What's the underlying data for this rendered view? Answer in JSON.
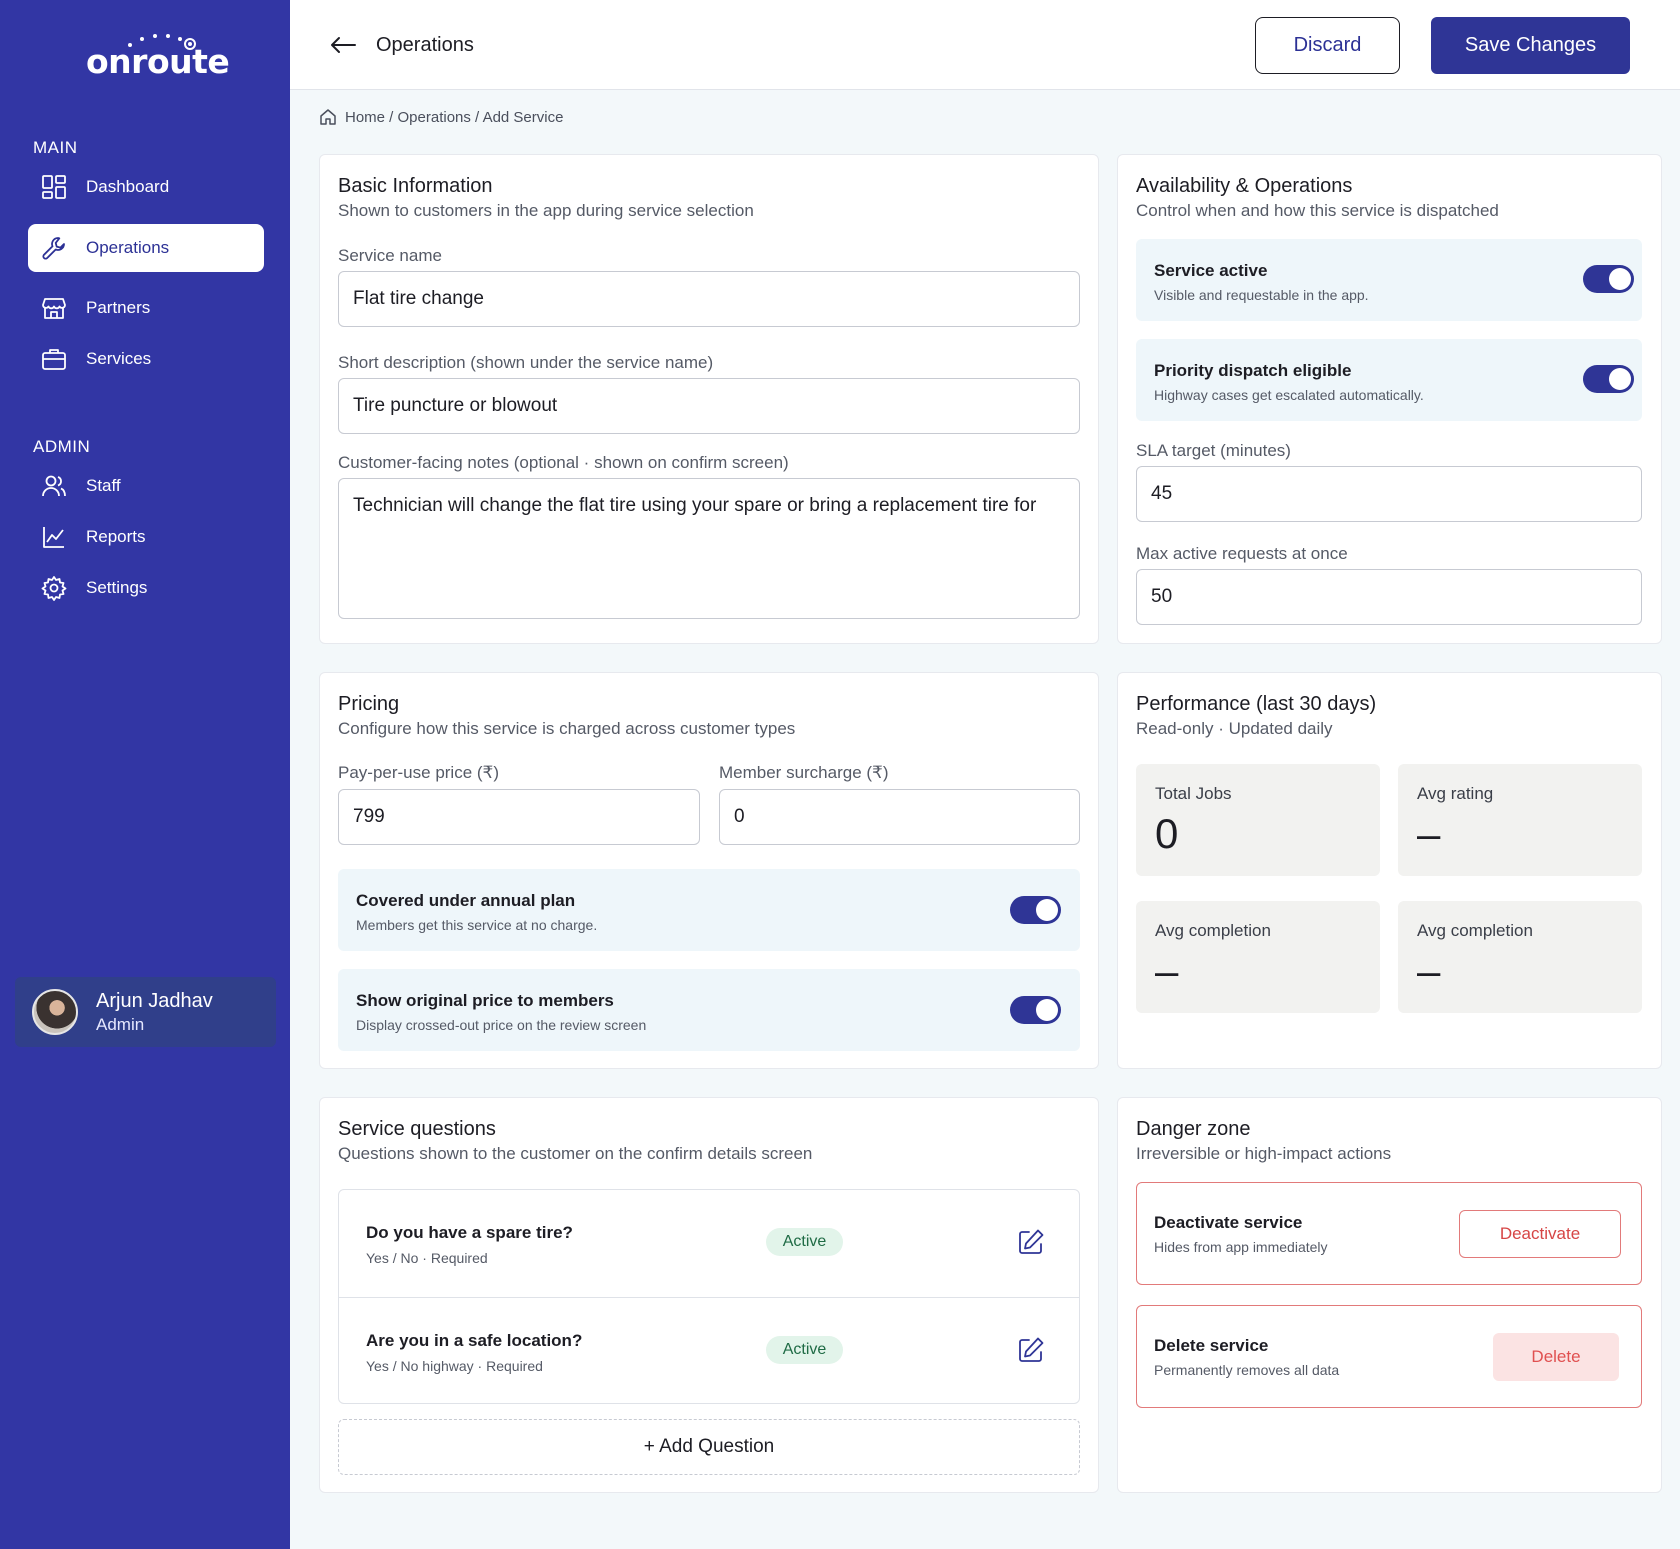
{
  "brand": {
    "logo_text": "onroute",
    "sidebar_color": "#3236a4",
    "accent": "#2f3596"
  },
  "sidebar": {
    "main_label": "MAIN",
    "admin_label": "ADMIN",
    "main_items": [
      {
        "label": "Dashboard",
        "icon": "grid-icon"
      },
      {
        "label": "Operations",
        "icon": "wrench-icon",
        "active": true
      },
      {
        "label": "Partners",
        "icon": "store-icon"
      },
      {
        "label": "Services",
        "icon": "briefcase-icon"
      }
    ],
    "admin_items": [
      {
        "label": "Staff",
        "icon": "users-icon"
      },
      {
        "label": "Reports",
        "icon": "chart-icon"
      },
      {
        "label": "Settings",
        "icon": "gear-icon"
      }
    ],
    "user": {
      "name": "Arjun Jadhav",
      "role": "Admin"
    }
  },
  "header": {
    "title": "Operations",
    "discard_label": "Discard",
    "save_label": "Save Changes"
  },
  "breadcrumb": "Home / Operations / Add Service",
  "basic_info": {
    "title": "Basic Information",
    "subtitle": "Shown to customers in the app during service selection",
    "service_name_label": "Service name",
    "service_name_value": "Flat tire change",
    "short_desc_label": "Short description (shown under the service name)",
    "short_desc_value": "Tire puncture or blowout",
    "notes_label": "Customer-facing notes (optional · shown on confirm screen)",
    "notes_value": "Technician will change the flat tire using your spare or bring a replacement tire for"
  },
  "availability": {
    "title": "Availability & Operations",
    "subtitle": "Control when and how this service is dispatched",
    "service_active_title": "Service active",
    "service_active_sub": "Visible and requestable in the app.",
    "service_active_on": true,
    "priority_title": "Priority dispatch eligible",
    "priority_sub": "Highway cases get escalated automatically.",
    "priority_on": true,
    "sla_label": "SLA target (minutes)",
    "sla_value": "45",
    "max_label": "Max active requests at once",
    "max_value": "50"
  },
  "pricing": {
    "title": "Pricing",
    "subtitle": "Configure how this service is charged across customer types",
    "ppu_label": "Pay-per-use price (₹)",
    "ppu_value": "799",
    "surcharge_label": "Member surcharge (₹)",
    "surcharge_value": "0",
    "covered_title": "Covered under annual plan",
    "covered_sub": "Members get this service at no charge.",
    "covered_on": true,
    "show_orig_title": "Show original price to members",
    "show_orig_sub": "Display crossed-out price on the review screen",
    "show_orig_on": true
  },
  "performance": {
    "title": "Performance (last 30 days)",
    "subtitle": "Read-only · Updated daily",
    "stats": [
      {
        "label": "Total Jobs",
        "value": "0"
      },
      {
        "label": "Avg rating",
        "value": "–"
      },
      {
        "label": "Avg completion",
        "value": "–"
      },
      {
        "label": "Avg completion",
        "value": "–"
      }
    ]
  },
  "questions": {
    "title": "Service questions",
    "subtitle": "Questions shown to the customer on the confirm details screen",
    "items": [
      {
        "title": "Do you have a spare tire?",
        "sub": "Yes / No · Required",
        "status": "Active"
      },
      {
        "title": "Are you in a safe location?",
        "sub": "Yes / No highway · Required",
        "status": "Active"
      }
    ],
    "add_label": "+ Add Question"
  },
  "danger": {
    "title": "Danger zone",
    "subtitle": "Irreversible or high-impact actions",
    "deactivate_title": "Deactivate service",
    "deactivate_sub": "Hides from app immediately",
    "deactivate_label": "Deactivate",
    "delete_title": "Delete service",
    "delete_sub": "Permanently removes all data",
    "delete_label": "Delete"
  }
}
